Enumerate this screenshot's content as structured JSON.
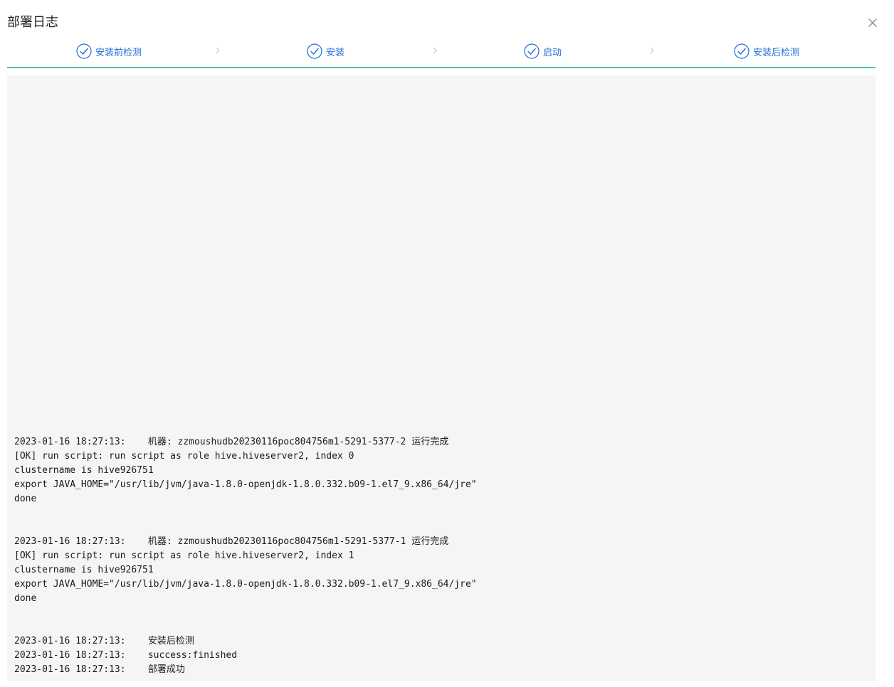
{
  "dialog": {
    "title": "部署日志",
    "close_icon": "close-icon"
  },
  "steps": [
    {
      "label": "安装前检测",
      "status": "done",
      "icon": "check-circle-icon"
    },
    {
      "label": "安装",
      "status": "done",
      "icon": "check-circle-icon"
    },
    {
      "label": "启动",
      "status": "done",
      "icon": "check-circle-icon"
    },
    {
      "label": "安装后检测",
      "status": "done",
      "icon": "check-circle-icon"
    }
  ],
  "colors": {
    "step_accent": "#1f6fd6",
    "divider": "#4fc1a8",
    "log_background": "#f5f5f5"
  },
  "log": {
    "lines": [
      "2023-01-16 18:27:13:    机器: zzmoushudb20230116poc804756m1-5291-5377-2 运行完成",
      "[OK] run script: run script as role hive.hiveserver2, index 0",
      "clustername is hive926751",
      "export JAVA_HOME=\"/usr/lib/jvm/java-1.8.0-openjdk-1.8.0.332.b09-1.el7_9.x86_64/jre\"",
      "done",
      "",
      "",
      "2023-01-16 18:27:13:    机器: zzmoushudb20230116poc804756m1-5291-5377-1 运行完成",
      "[OK] run script: run script as role hive.hiveserver2, index 1",
      "clustername is hive926751",
      "export JAVA_HOME=\"/usr/lib/jvm/java-1.8.0-openjdk-1.8.0.332.b09-1.el7_9.x86_64/jre\"",
      "done",
      "",
      "",
      "2023-01-16 18:27:13:    安装后检测",
      "2023-01-16 18:27:13:    success:finished",
      "2023-01-16 18:27:13:    部署成功"
    ]
  }
}
